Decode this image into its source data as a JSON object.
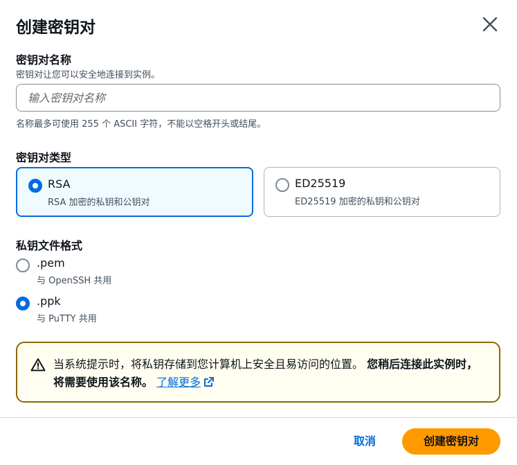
{
  "modal": {
    "title": "创建密钥对",
    "close_icon": "close-icon"
  },
  "key_name": {
    "label": "密钥对名称",
    "description": "密钥对让您可以安全地连接到实例。",
    "placeholder": "输入密钥对名称",
    "value": "",
    "constraint": "名称最多可使用 255 个 ASCII 字符，不能以空格开头或结尾。"
  },
  "key_type": {
    "label": "密钥对类型",
    "options": [
      {
        "title": "RSA",
        "description": "RSA 加密的私钥和公钥对",
        "selected": true
      },
      {
        "title": "ED25519",
        "description": "ED25519 加密的私钥和公钥对",
        "selected": false
      }
    ]
  },
  "file_format": {
    "label": "私钥文件格式",
    "options": [
      {
        "title": ".pem",
        "description": "与 OpenSSH 共用",
        "selected": false
      },
      {
        "title": ".ppk",
        "description": "与 PuTTY 共用",
        "selected": true
      }
    ]
  },
  "alert": {
    "icon": "warning-icon",
    "text": "当系统提示时，将私钥存储到您计算机上安全且易访问的位置。",
    "strong_text": "您稍后连接此实例时，将需要使用该名称。",
    "link_text": "了解更多",
    "link_icon": "external-link-icon"
  },
  "footer": {
    "cancel_label": "取消",
    "create_label": "创建密钥对"
  },
  "colors": {
    "accent": "#006ce0",
    "primary_button": "#ff9900",
    "warning_border": "#8d6605",
    "warning_bg": "#fffef0",
    "selected_card_bg": "#f0fbff"
  }
}
